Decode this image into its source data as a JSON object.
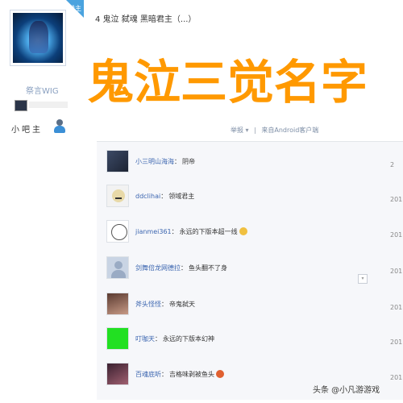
{
  "sidebar": {
    "corner_tag": "楼主",
    "username": "祭言WIG",
    "owner_label": "小吧主"
  },
  "thread": {
    "title": "4 鬼泣 弑魂 黑暗君主（...）"
  },
  "overlay": {
    "title": "鬼泣三觉名字"
  },
  "meta": {
    "report": "举报",
    "caret": "▾",
    "separator": "|",
    "source": "来自Android客户端"
  },
  "replies": [
    {
      "user": "小三明山海海",
      "content": "阴帝",
      "year": "2",
      "avatar": "avatar-dark"
    },
    {
      "user": "ddclihai",
      "content": "领域君主",
      "year": "201",
      "avatar": "avatar-meme"
    },
    {
      "user": "jianmei361",
      "content": "永远的下版本超一线",
      "year": "201",
      "avatar": "avatar-sketch",
      "emoji": true
    },
    {
      "user": "剑舞倍龙网德拉",
      "content": "鱼头翻不了身",
      "year": "201",
      "avatar": "avatar-default"
    },
    {
      "user": "斧头怪怪",
      "content": "帝鬼弑天",
      "year": "201",
      "avatar": "avatar-photo"
    },
    {
      "user": "叮咖天",
      "content": "永远的下版本幻神",
      "year": "201",
      "avatar": "avatar-green"
    },
    {
      "user": "百魂底听",
      "content": "吉格味剥被鱼头",
      "year": "201",
      "avatar": "avatar-photo2",
      "emoji": true
    }
  ],
  "watermark": "头条 @小凡游游戏"
}
